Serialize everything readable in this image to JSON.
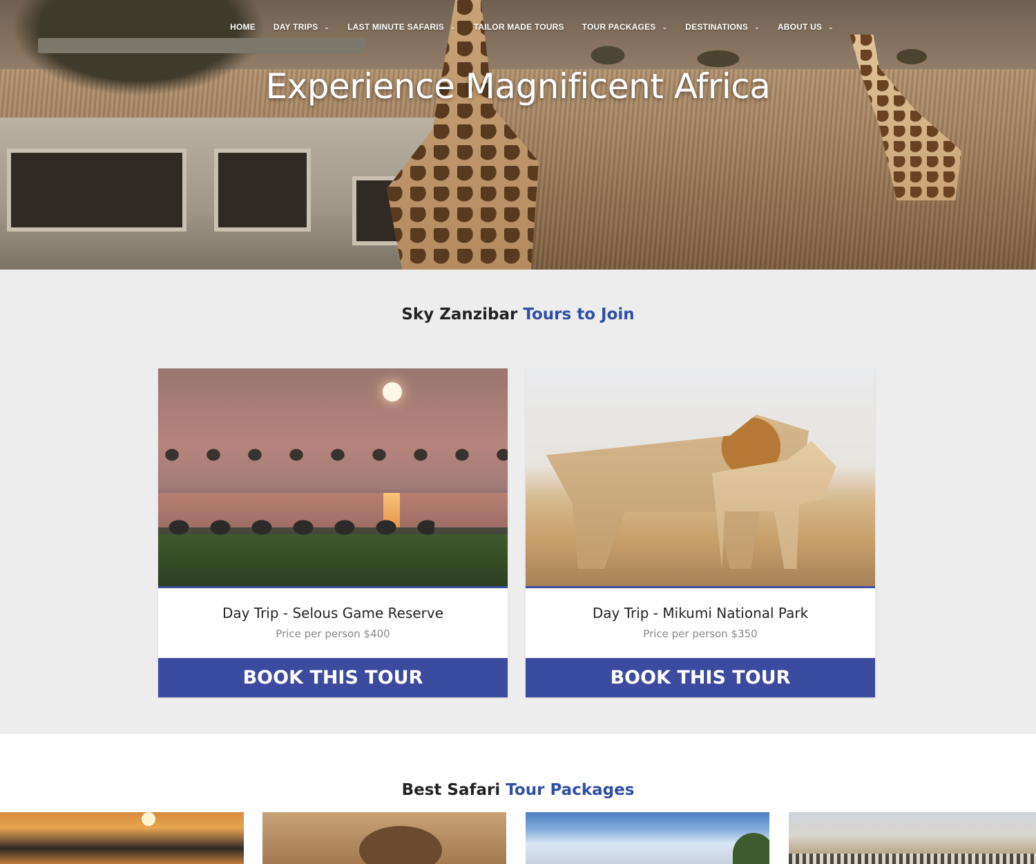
{
  "nav": {
    "items": [
      {
        "label": "HOME",
        "dropdown": false
      },
      {
        "label": "DAY TRIPS",
        "dropdown": true
      },
      {
        "label": "LAST MINUTE SAFARIS",
        "dropdown": true
      },
      {
        "label": "TAILOR MADE TOURS",
        "dropdown": false
      },
      {
        "label": "TOUR PACKAGES",
        "dropdown": true
      },
      {
        "label": "DESTINATIONS",
        "dropdown": true
      },
      {
        "label": "ABOUT US",
        "dropdown": true
      }
    ],
    "chevron_icon": "chevron-down-icon"
  },
  "hero": {
    "title": "Experience Magnificent Africa"
  },
  "tours_section": {
    "title_plain": "Sky Zanzibar",
    "title_accent": "Tours to Join",
    "accent_color": "#2f4fa6",
    "cards": [
      {
        "name": "Day Trip - Selous Game Reserve",
        "price": "Price per person $400",
        "button": "BOOK THIS TOUR"
      },
      {
        "name": "Day Trip - Mikumi National Park",
        "price": "Price per person $350",
        "button": "BOOK THIS TOUR"
      }
    ],
    "button_color": "#3b4ba0"
  },
  "packages_section": {
    "title_plain": "Best Safari",
    "title_accent": "Tour Packages"
  }
}
